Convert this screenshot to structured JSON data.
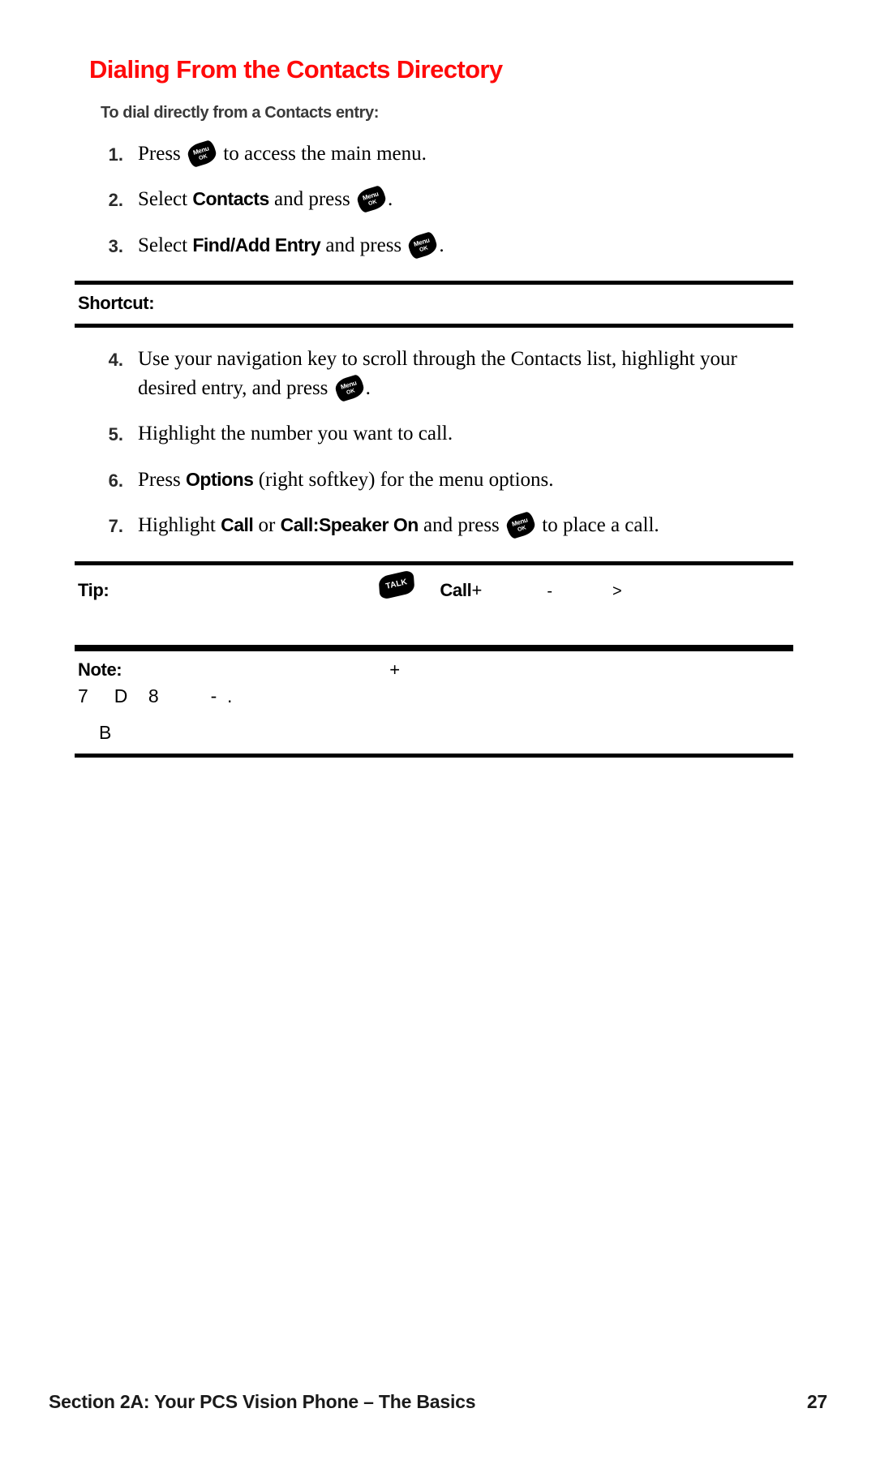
{
  "heading": {
    "title": "Dialing From the Contacts Directory",
    "title_color": "#ff0a0a",
    "subhead": "To dial directly from a Contacts entry:"
  },
  "keys": {
    "menu_ok": {
      "top": "Menu",
      "bottom": "OK",
      "name": "menu-ok-key"
    },
    "talk": {
      "top": "TALK",
      "bottom": "",
      "name": "talk-key"
    }
  },
  "steps_first": [
    {
      "num": "1.",
      "parts": [
        {
          "t": "text",
          "v": "Press "
        },
        {
          "t": "key",
          "v": "menu_ok"
        },
        {
          "t": "text",
          "v": " to access the main menu."
        }
      ]
    },
    {
      "num": "2.",
      "parts": [
        {
          "t": "text",
          "v": "Select "
        },
        {
          "t": "bold",
          "v": "Contacts"
        },
        {
          "t": "text",
          "v": " and press "
        },
        {
          "t": "key",
          "v": "menu_ok"
        },
        {
          "t": "text",
          "v": "."
        }
      ]
    },
    {
      "num": "3.",
      "parts": [
        {
          "t": "text",
          "v": "Select "
        },
        {
          "t": "bold",
          "v": "Find/Add Entry"
        },
        {
          "t": "text",
          "v": " and press "
        },
        {
          "t": "key",
          "v": "menu_ok"
        },
        {
          "t": "text",
          "v": "."
        }
      ]
    }
  ],
  "shortcut_box": {
    "label": "Shortcut:",
    "body": ""
  },
  "steps_second": [
    {
      "num": "4.",
      "parts": [
        {
          "t": "text",
          "v": "Use your navigation key to scroll through the Contacts list, highlight your desired entry, and press "
        },
        {
          "t": "key",
          "v": "menu_ok"
        },
        {
          "t": "text",
          "v": "."
        }
      ]
    },
    {
      "num": "5.",
      "parts": [
        {
          "t": "text",
          "v": "Highlight the number you want to call."
        }
      ]
    },
    {
      "num": "6.",
      "parts": [
        {
          "t": "text",
          "v": "Press "
        },
        {
          "t": "bold",
          "v": "Options"
        },
        {
          "t": "text",
          "v": " (right softkey) for the menu options."
        }
      ]
    },
    {
      "num": "7.",
      "parts": [
        {
          "t": "text",
          "v": "Highlight "
        },
        {
          "t": "bold",
          "v": "Call"
        },
        {
          "t": "text",
          "v": " or "
        },
        {
          "t": "bold",
          "v": "Call:Speaker On"
        },
        {
          "t": "text",
          "v": " and press "
        },
        {
          "t": "key",
          "v": "menu_ok"
        },
        {
          "t": "text",
          "v": " to place a call."
        }
      ]
    }
  ],
  "tip_box": {
    "label": "Tip:",
    "frag_call": "Call",
    "frag_plus": "+",
    "frag_dash": "-",
    "frag_gt": ">"
  },
  "note_box": {
    "label": "Note:",
    "plus": "+",
    "line2": "7     D    8          -  .",
    "line3": "B"
  },
  "footer": {
    "left": "Section 2A: Your PCS Vision Phone – The Basics",
    "page": "27"
  }
}
